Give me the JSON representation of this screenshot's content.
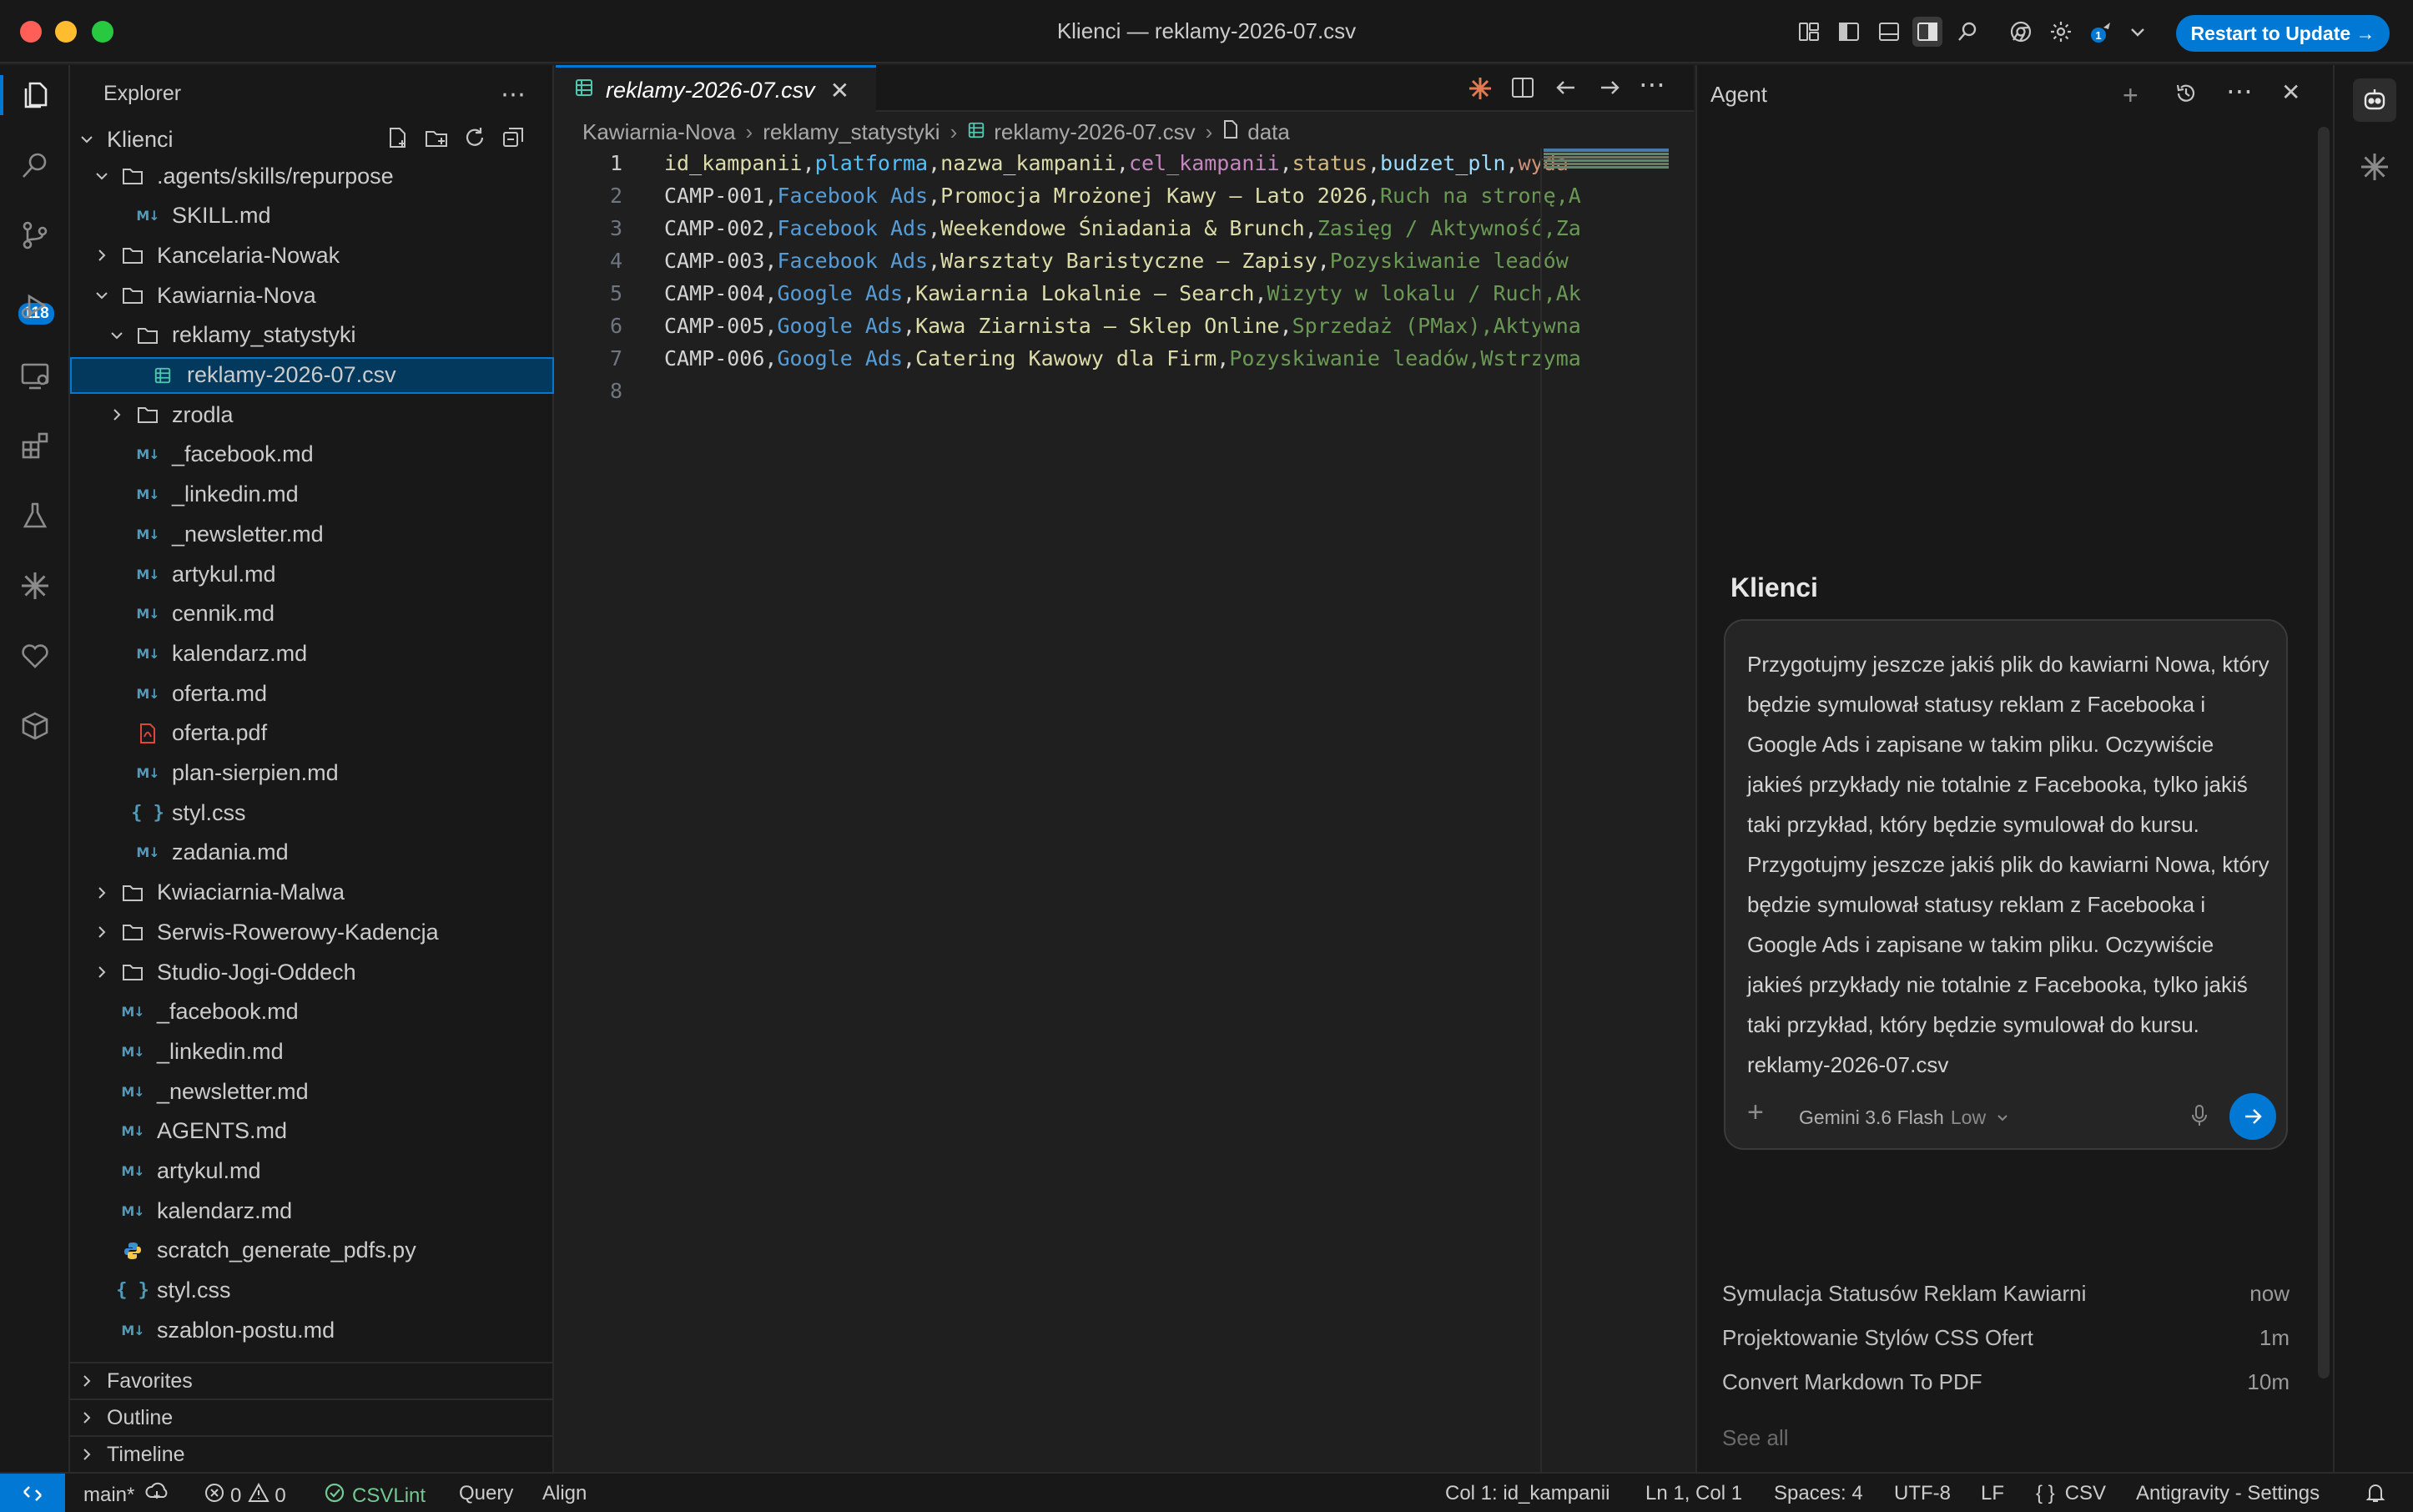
{
  "window": {
    "title": "Klienci — reklamy-2026-07.csv"
  },
  "titlebar": {
    "restart_label": "Restart to Update →"
  },
  "activity": {
    "source_control_badge": "118"
  },
  "explorer": {
    "header": "Explorer",
    "root": "Klienci",
    "items": [
      {
        "label": ".agents/skills/repurpose",
        "type": "folder-open"
      },
      {
        "label": "SKILL.md",
        "type": "md"
      },
      {
        "label": "Kancelaria-Nowak",
        "type": "folder"
      },
      {
        "label": "Kawiarnia-Nova",
        "type": "folder-open"
      },
      {
        "label": "reklamy_statystyki",
        "type": "folder-open"
      },
      {
        "label": "reklamy-2026-07.csv",
        "type": "csv"
      },
      {
        "label": "zrodla",
        "type": "folder"
      },
      {
        "label": "_facebook.md",
        "type": "md"
      },
      {
        "label": "_linkedin.md",
        "type": "md"
      },
      {
        "label": "_newsletter.md",
        "type": "md"
      },
      {
        "label": "artykul.md",
        "type": "md"
      },
      {
        "label": "cennik.md",
        "type": "md"
      },
      {
        "label": "kalendarz.md",
        "type": "md"
      },
      {
        "label": "oferta.md",
        "type": "md"
      },
      {
        "label": "oferta.pdf",
        "type": "pdf"
      },
      {
        "label": "plan-sierpien.md",
        "type": "md"
      },
      {
        "label": "styl.css",
        "type": "css"
      },
      {
        "label": "zadania.md",
        "type": "md"
      },
      {
        "label": "Kwiaciarnia-Malwa",
        "type": "folder"
      },
      {
        "label": "Serwis-Rowerowy-Kadencja",
        "type": "folder"
      },
      {
        "label": "Studio-Jogi-Oddech",
        "type": "folder"
      },
      {
        "label": "_facebook.md",
        "type": "md"
      },
      {
        "label": "_linkedin.md",
        "type": "md"
      },
      {
        "label": "_newsletter.md",
        "type": "md"
      },
      {
        "label": "AGENTS.md",
        "type": "md"
      },
      {
        "label": "artykul.md",
        "type": "md"
      },
      {
        "label": "kalendarz.md",
        "type": "md"
      },
      {
        "label": "scratch_generate_pdfs.py",
        "type": "py"
      },
      {
        "label": "styl.css",
        "type": "css"
      },
      {
        "label": "szablon-postu.md",
        "type": "md"
      }
    ],
    "panes": [
      "Favorites",
      "Outline",
      "Timeline"
    ]
  },
  "editor": {
    "tab_label": "reklamy-2026-07.csv",
    "breadcrumb": [
      "Kawiarnia-Nova",
      "reklamy_statystyki",
      "reklamy-2026-07.csv",
      "data"
    ],
    "line_numbers": [
      "1",
      "2",
      "3",
      "4",
      "5",
      "6",
      "7",
      "8"
    ],
    "lines": [
      [
        [
          "id_kampanii",
          "#dcdcaa"
        ],
        [
          ",",
          "#d4d4d4"
        ],
        [
          "platforma",
          "#4fc1ff"
        ],
        [
          ",",
          "#d4d4d4"
        ],
        [
          "nazwa_kampanii",
          "#dcdcaa"
        ],
        [
          ",",
          "#d4d4d4"
        ],
        [
          "cel_kampanii",
          "#c586c0"
        ],
        [
          ",",
          "#d4d4d4"
        ],
        [
          "status",
          "#d7ba7d"
        ],
        [
          ",",
          "#d4d4d4"
        ],
        [
          "budzet_pln",
          "#9cdcfe"
        ],
        [
          ",",
          "#d4d4d4"
        ],
        [
          "wyda",
          "#ce9178"
        ]
      ],
      [
        [
          "CAMP-001",
          "#d4d4d4"
        ],
        [
          ",",
          "#d4d4d4"
        ],
        [
          "Facebook Ads",
          "#569cd6"
        ],
        [
          ",",
          "#d4d4d4"
        ],
        [
          "Promocja Mrożonej Kawy – Lato 2026",
          "#dcdcaa"
        ],
        [
          ",",
          "#d4d4d4"
        ],
        [
          "Ruch na stronę,A",
          "#6a9955"
        ]
      ],
      [
        [
          "CAMP-002",
          "#d4d4d4"
        ],
        [
          ",",
          "#d4d4d4"
        ],
        [
          "Facebook Ads",
          "#569cd6"
        ],
        [
          ",",
          "#d4d4d4"
        ],
        [
          "Weekendowe Śniadania & Brunch",
          "#dcdcaa"
        ],
        [
          ",",
          "#d4d4d4"
        ],
        [
          "Zasięg / Aktywność,Za",
          "#6a9955"
        ]
      ],
      [
        [
          "CAMP-003",
          "#d4d4d4"
        ],
        [
          ",",
          "#d4d4d4"
        ],
        [
          "Facebook Ads",
          "#569cd6"
        ],
        [
          ",",
          "#d4d4d4"
        ],
        [
          "Warsztaty Baristyczne – Zapisy",
          "#dcdcaa"
        ],
        [
          ",",
          "#d4d4d4"
        ],
        [
          "Pozyskiwanie leadów",
          "#6a9955"
        ]
      ],
      [
        [
          "CAMP-004",
          "#d4d4d4"
        ],
        [
          ",",
          "#d4d4d4"
        ],
        [
          "Google Ads",
          "#569cd6"
        ],
        [
          ",",
          "#d4d4d4"
        ],
        [
          "Kawiarnia Lokalnie – Search",
          "#dcdcaa"
        ],
        [
          ",",
          "#d4d4d4"
        ],
        [
          "Wizyty w lokalu / Ruch,Ak",
          "#6a9955"
        ]
      ],
      [
        [
          "CAMP-005",
          "#d4d4d4"
        ],
        [
          ",",
          "#d4d4d4"
        ],
        [
          "Google Ads",
          "#569cd6"
        ],
        [
          ",",
          "#d4d4d4"
        ],
        [
          "Kawa Ziarnista – Sklep Online",
          "#dcdcaa"
        ],
        [
          ",",
          "#d4d4d4"
        ],
        [
          "Sprzedaż (PMax),Aktywna",
          "#6a9955"
        ]
      ],
      [
        [
          "CAMP-006",
          "#d4d4d4"
        ],
        [
          ",",
          "#d4d4d4"
        ],
        [
          "Google Ads",
          "#569cd6"
        ],
        [
          ",",
          "#d4d4d4"
        ],
        [
          "Catering Kawowy dla Firm",
          "#dcdcaa"
        ],
        [
          ",",
          "#d4d4d4"
        ],
        [
          "Pozyskiwanie leadów,Wstrzyma",
          "#6a9955"
        ]
      ],
      []
    ]
  },
  "agent": {
    "title": "Agent",
    "workspace": "Klienci",
    "message": "Przygotujmy jeszcze jakiś plik do kawiarni Nowa, który będzie symulował statusy reklam z Facebooka i Google Ads i zapisane w takim pliku. Oczywiście jakieś przykłady nie totalnie z Facebooka, tylko jakiś taki przykład, który będzie symulował do kursu. Przygotujmy jeszcze jakiś plik do kawiarni Nowa, który będzie symulował statusy reklam z Facebooka i Google Ads i zapisane w takim pliku. Oczywiście jakieś przykłady nie totalnie z Facebooka, tylko jakiś taki przykład, który będzie symulował do kursu. reklamy-2026-07.csv",
    "model": "Gemini 3.6 Flash",
    "model_level": "Low",
    "conversations": [
      {
        "title": "Symulacja Statusów Reklam Kawiarni",
        "time": "now"
      },
      {
        "title": "Projektowanie Stylów CSS Ofert",
        "time": "1m"
      },
      {
        "title": "Convert Markdown To PDF",
        "time": "10m"
      }
    ],
    "see_all": "See all"
  },
  "statusbar": {
    "branch": "main*",
    "errors": "0",
    "warnings": "0",
    "csvlint": "CSVLint",
    "query": "Query",
    "align": "Align",
    "column": "Col 1: id_kampanii",
    "position": "Ln 1, Col 1",
    "spaces": "Spaces: 4",
    "encoding": "UTF-8",
    "eol": "LF",
    "language": "CSV",
    "settings": "Antigravity - Settings"
  },
  "colors": {
    "accent": "#0078d4",
    "selection": "#04395e",
    "close": "#ff5f57",
    "minimize": "#febc2e",
    "zoom": "#28c840"
  }
}
